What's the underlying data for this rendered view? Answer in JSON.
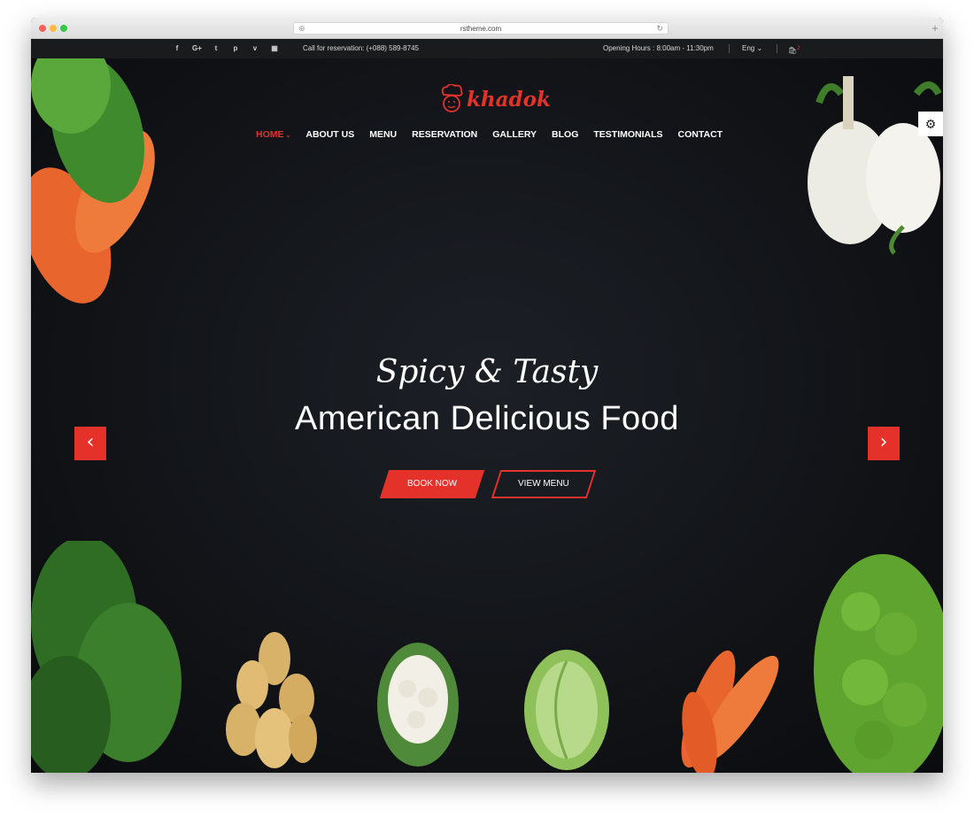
{
  "browser": {
    "url": "rstheme.com"
  },
  "topbar": {
    "social_icons": [
      "facebook-icon",
      "google-plus-icon",
      "twitter-icon",
      "pinterest-icon",
      "vimeo-icon",
      "map-icon"
    ],
    "social_glyphs": [
      "f",
      "G+",
      "t",
      "p",
      "v",
      "▦"
    ],
    "reservation": "Call for reservation: (+088) 589-8745",
    "hours": "Opening Hours : 8:00am - 11:30pm",
    "language": "Eng",
    "cart_count": "2"
  },
  "brand": {
    "logo_text": "khadok",
    "accent_color": "#e4322b"
  },
  "nav": {
    "items": [
      "HOME",
      "ABOUT US",
      "MENU",
      "RESERVATION",
      "GALLERY",
      "BLOG",
      "TESTIMONIALS",
      "CONTACT"
    ],
    "active": "HOME"
  },
  "hero": {
    "script_title": "Spicy & Tasty",
    "headline": "American Delicious Food",
    "book_button": "BOOK NOW",
    "view_button": "VIEW MENU",
    "prev_arrow": "‹",
    "next_arrow": "›"
  }
}
